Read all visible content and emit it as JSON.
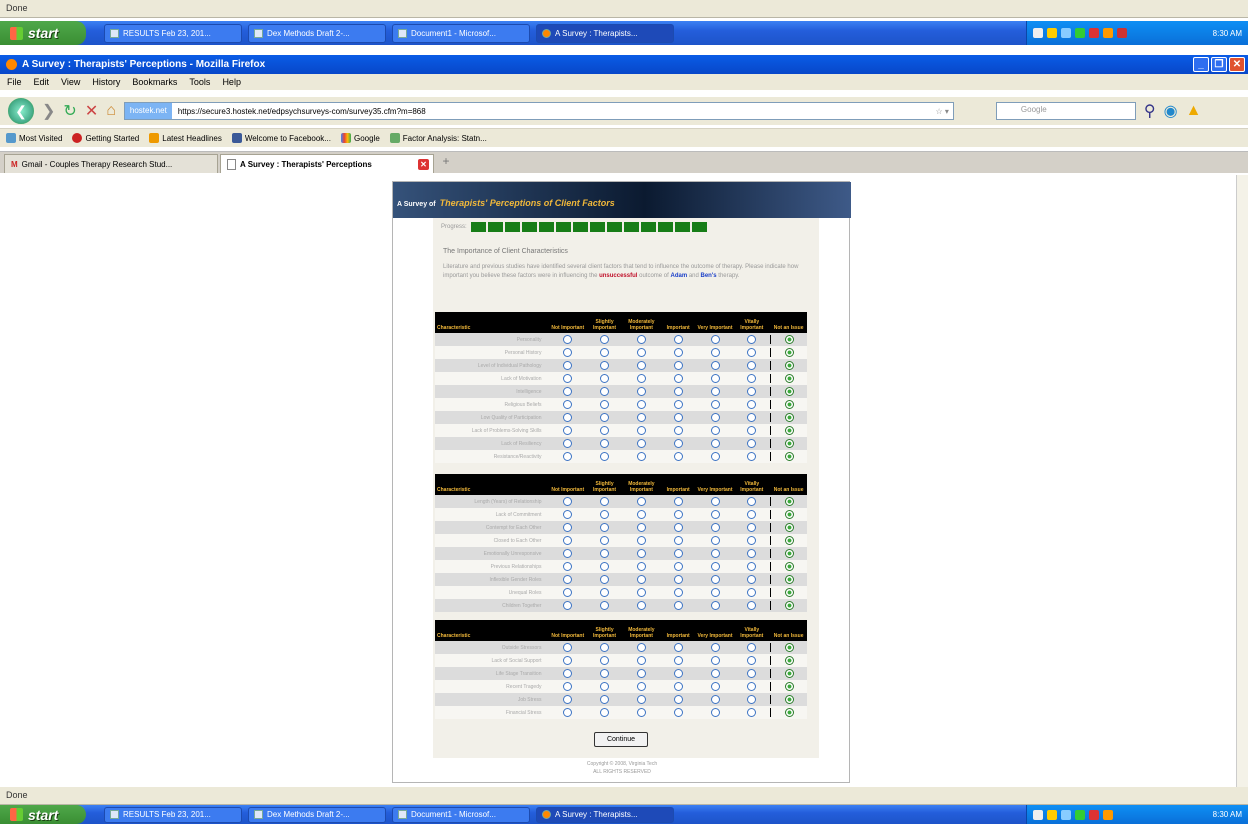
{
  "status": {
    "text": "Done"
  },
  "taskbar": {
    "start": "start",
    "buttons": [
      "RESULTS Feb 23, 201...",
      "Dex Methods Draft 2-...",
      "Document1 - Microsof...",
      "A Survey : Therapists..."
    ],
    "time": "8:30 AM"
  },
  "window": {
    "title": "A Survey : Therapists' Perceptions - Mozilla Firefox"
  },
  "menu": [
    "File",
    "Edit",
    "View",
    "History",
    "Bookmarks",
    "Tools",
    "Help"
  ],
  "nav": {
    "site_badge": "hostek.net",
    "url": "https://secure3.hostek.net/edpsychsurveys-com/survey35.cfm?m=868",
    "search_placeholder": "Google"
  },
  "bookmarks": [
    "Most Visited",
    "Getting Started",
    "Latest Headlines",
    "Welcome to Facebook...",
    "Google",
    "Factor Analysis: Statn..."
  ],
  "tabs": [
    "Gmail - Couples Therapy Research Stud...",
    "A Survey : Therapists' Perceptions"
  ],
  "survey": {
    "banner_prefix": "A Survey of",
    "banner_title": "Therapists' Perceptions of Client Factors",
    "progress_label": "Progress:",
    "progress_cells": 14,
    "heading": "The Importance of Client Characteristics",
    "intro": "Literature and previous studies have identified several client factors that tend to influence the outcome of therapy. Please indicate how important you believe these factors were in influencing the",
    "intro_emph": "unsuccessful",
    "intro_mid": "outcome of",
    "intro_name1": "Adam",
    "intro_and": "and",
    "intro_name2": "Ben's",
    "intro_end": "therapy.",
    "columns": [
      "Characteristic",
      "Not Important",
      "Slightly Important",
      "Moderately Important",
      "Important",
      "Very Important",
      "Vitally Important",
      "Not an Issue"
    ],
    "group1": [
      "Personality",
      "Personal History",
      "Level of Individual Pathology",
      "Lack of Motivation",
      "Intelligence",
      "Religious Beliefs",
      "Low Quality of Participation",
      "Lack of Problems-Solving Skills",
      "Lack of Resiliency",
      "Resistance/Reactivity"
    ],
    "group2": [
      "Length (Years) of Relationship",
      "Lack of Commitment",
      "Contempt for Each Other",
      "Closed to Each Other",
      "Emotionally Unresponsive",
      "Previous Relationships",
      "Inflexible Gender Roles",
      "Unequal Roles",
      "Children Together"
    ],
    "group3": [
      "Outside Stressors",
      "Lack of Social Support",
      "Life Stage Transition",
      "Recent Tragedy",
      "Job Stress",
      "Financial Stress"
    ],
    "continue": "Continue",
    "copyright": "Copyright © 2008, Virginia Tech",
    "rights": "ALL RIGHTS RESERVED"
  }
}
